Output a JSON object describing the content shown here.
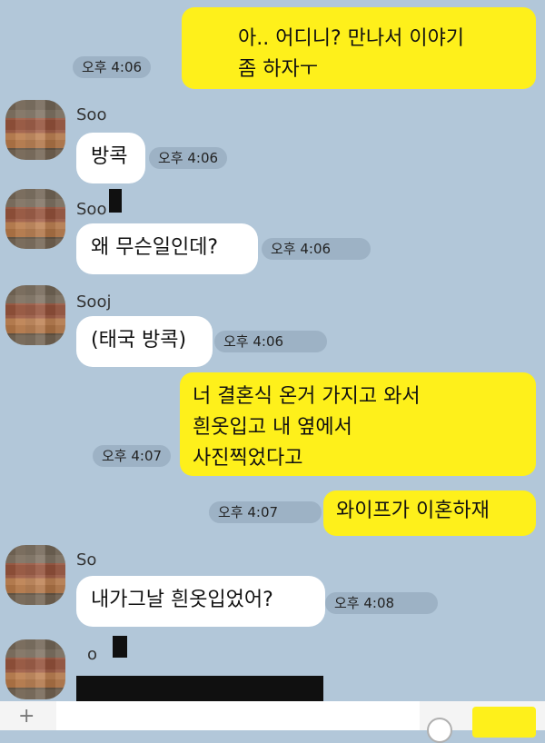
{
  "messages": [
    {
      "side": "me",
      "text": "아.. 어디니? 만나서 이야기\n좀 하자ㅜ",
      "time": "오후 4:06"
    },
    {
      "side": "other",
      "sender": "Soo",
      "text": "방콕",
      "time": "오후 4:06"
    },
    {
      "side": "other",
      "sender": "Soo",
      "text": "왜 무슨일인데?",
      "time": "오후 4:06"
    },
    {
      "side": "other",
      "sender": "Sooj",
      "text": "(태국 방콕)",
      "time": "오후 4:06"
    },
    {
      "side": "me",
      "text": "너 결혼식 온거 가지고 와서\n흰옷입고 내 옆에서\n사진찍었다고",
      "time": "오후 4:07"
    },
    {
      "side": "me",
      "text": "와이프가 이혼하재",
      "time": "오후 4:07"
    },
    {
      "side": "other",
      "sender": "So",
      "text": "내가그날 흰옷입었어?",
      "time": "오후 4:08"
    },
    {
      "side": "other",
      "sender": "o",
      "text": ""
    }
  ],
  "colors": {
    "background": "#b2c7d9",
    "my_bubble": "#fef01b",
    "other_bubble": "#ffffff"
  }
}
